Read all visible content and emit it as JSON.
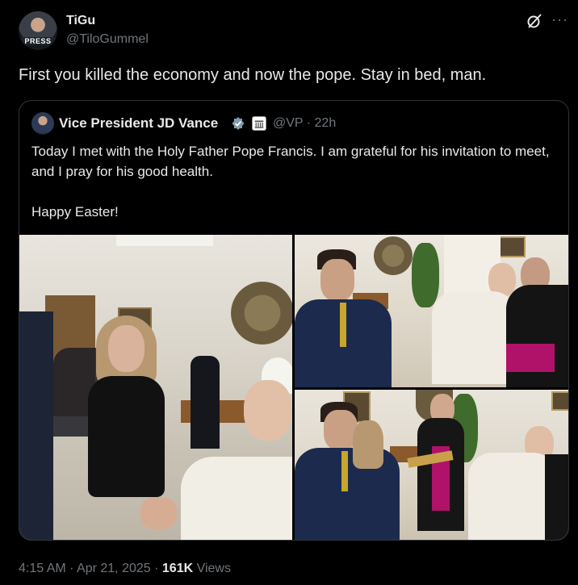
{
  "author": {
    "name": "TiGu",
    "handle": "@TiloGummel",
    "avatar_text": "PRESS"
  },
  "tweet": {
    "text": "First you killed the economy and now the pope. Stay in bed, man."
  },
  "quoted": {
    "name": "Vice President JD Vance",
    "handle": "@VP · 22h",
    "text_line1": "Today I met with the Holy Father Pope Francis. I am grateful for his invitation to meet, and I pray for his good health.",
    "text_line2": "Happy Easter!",
    "photo_count": 3
  },
  "meta": {
    "time": "4:15 AM · Apr 21, 2025 · ",
    "views_count": "161K",
    "views_label": " Views"
  },
  "icons": {
    "grok": "grok-icon",
    "more": "more-icon",
    "verified": "verified-badge-icon",
    "gov": "government-affiliation-icon"
  },
  "colors": {
    "background": "#000000",
    "text": "#e7e9ea",
    "muted": "#71767b",
    "border": "#2f3336",
    "verified": "#829aab"
  }
}
